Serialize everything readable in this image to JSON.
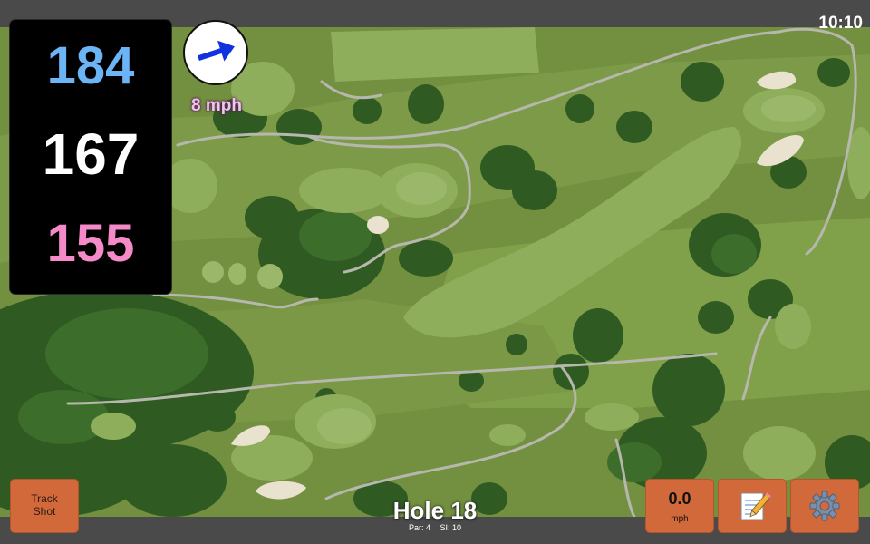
{
  "status_bar": {
    "clock": "10:10"
  },
  "yardages": {
    "back": "184",
    "middle": "167",
    "front": "155",
    "colors": {
      "back": "#6bb4f5",
      "middle": "#ffffff",
      "front": "#f58ac8"
    }
  },
  "wind": {
    "speed_label": "8 mph",
    "direction_icon": "arrow-east-northeast",
    "arrow_color": "#1032e0"
  },
  "hole": {
    "title": "Hole 18",
    "par_label": "Par: 4",
    "si_label": "SI: 10"
  },
  "buttons": {
    "track_shot": {
      "label": "Track\nShot"
    },
    "speed": {
      "value": "0.0",
      "unit": "mph"
    },
    "notes": {
      "icon": "memo-icon"
    },
    "settings": {
      "icon": "gear-icon"
    }
  },
  "theme": {
    "button_color": "#d2693b",
    "bar_color": "#4a4a4a",
    "map_base": "#6d8a3f"
  }
}
